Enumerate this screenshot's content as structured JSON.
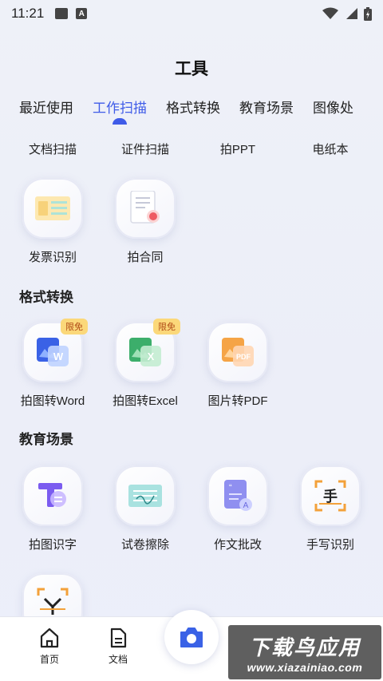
{
  "status_bar": {
    "time": "11:21",
    "a_icon": "A"
  },
  "title": "工具",
  "tabs": [
    {
      "label": "最近使用",
      "active": false
    },
    {
      "label": "工作扫描",
      "active": true
    },
    {
      "label": "格式转换",
      "active": false
    },
    {
      "label": "教育场景",
      "active": false
    },
    {
      "label": "图像处",
      "active": false
    }
  ],
  "work_scan": {
    "row1": [
      "文档扫描",
      "证件扫描",
      "拍PPT",
      "电纸本"
    ],
    "row2": [
      "发票识别",
      "拍合同"
    ]
  },
  "format_section": {
    "title": "格式转换",
    "items": [
      {
        "label": "拍图转Word",
        "badge": "限免"
      },
      {
        "label": "拍图转Excel",
        "badge": "限免"
      },
      {
        "label": "图片转PDF"
      }
    ]
  },
  "edu_section": {
    "title": "教育场景",
    "items": [
      {
        "label": "拍图识字"
      },
      {
        "label": "试卷擦除"
      },
      {
        "label": "作文批改"
      },
      {
        "label": "手写识别"
      }
    ]
  },
  "icon_text": {
    "word": "W",
    "excel": "X",
    "pdf": "PDF",
    "hand": "手",
    "essay": "A"
  },
  "bottom_nav": {
    "home": "首页",
    "docs": "文档"
  },
  "watermark": {
    "main": "下载鸟应用",
    "sub": "www.xiazainiao.com"
  },
  "colors": {
    "accent": "#3f5be8",
    "badge_bg": "#fbd87a",
    "badge_text": "#b14b17"
  }
}
